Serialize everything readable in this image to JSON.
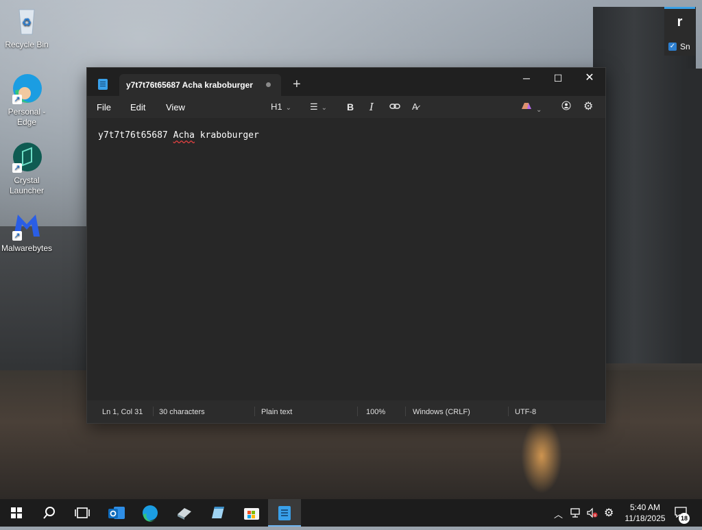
{
  "desktop": {
    "icons": [
      {
        "label": "Recycle Bin",
        "icon": "recycle-bin-icon"
      },
      {
        "label": "Personal - Edge",
        "icon": "edge-icon"
      },
      {
        "label": "Crystal Launcher",
        "icon": "crystal-launcher-icon"
      },
      {
        "label": "Malwarebytes",
        "icon": "malwarebytes-icon"
      }
    ]
  },
  "widget": {
    "letter": "r",
    "label": "Sn",
    "checked": true
  },
  "notepad": {
    "tab_title": "y7t7t76t65687 Acha kraboburger",
    "menu": {
      "file": "File",
      "edit": "Edit",
      "view": "View"
    },
    "toolbar": {
      "heading": "H1"
    },
    "content": {
      "before": "y7t7t76t65687 ",
      "misspelled": "Acha",
      "after": " kraboburger"
    },
    "status": {
      "position": "Ln 1, Col 31",
      "characters": "30 characters",
      "format": "Plain text",
      "zoom": "100%",
      "line_ending": "Windows (CRLF)",
      "encoding": "UTF-8"
    }
  },
  "taskbar": {
    "apps": [
      "start-icon",
      "search-icon",
      "task-view-icon",
      "outlook-icon",
      "edge-icon",
      "crystal-launcher-icon",
      "notepad-alt-icon",
      "store-icon",
      "notepad-icon"
    ],
    "clock": {
      "time": "5:40 AM",
      "date": "11/18/2025"
    },
    "notifications": "18"
  },
  "colors": {
    "accent": "#39a0ea",
    "window_bg": "#202020",
    "taskbar_bg": "#1c1c1c"
  }
}
